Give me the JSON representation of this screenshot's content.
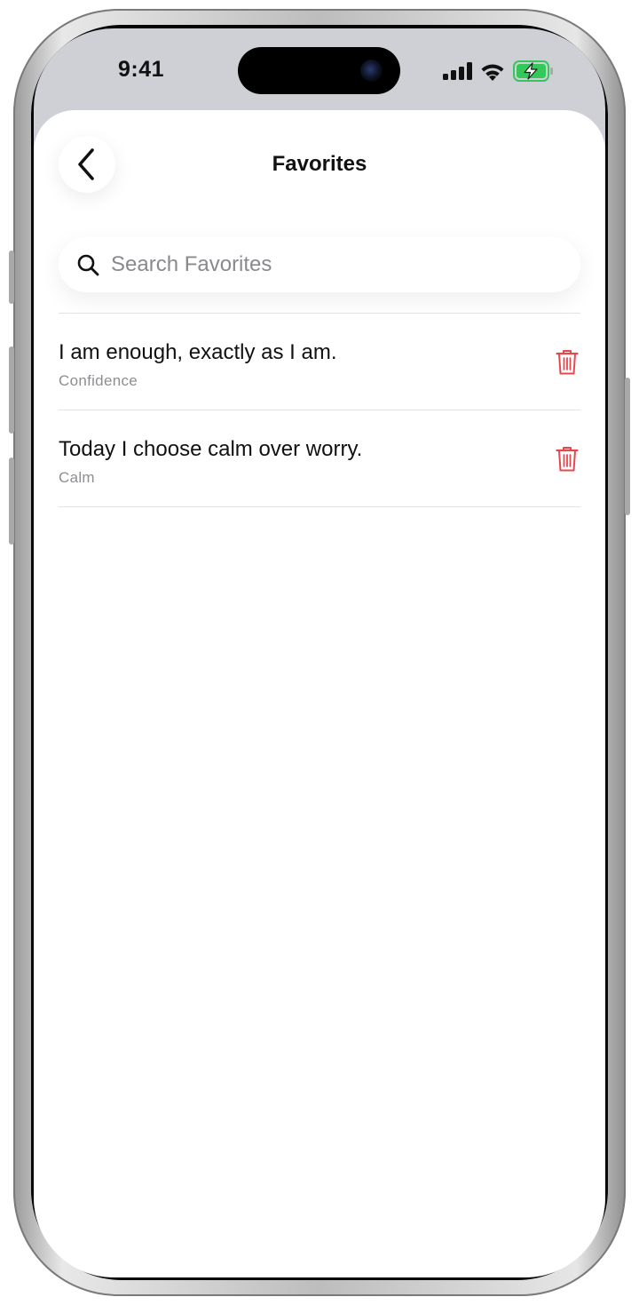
{
  "status_bar": {
    "time": "9:41",
    "icons": [
      "cellular-signal-icon",
      "wifi-icon",
      "battery-charging-icon"
    ]
  },
  "header": {
    "title": "Favorites",
    "back_icon": "chevron-left-icon"
  },
  "search": {
    "placeholder": "Search Favorites",
    "value": "",
    "icon": "magnifying-glass-icon"
  },
  "favorites": [
    {
      "text": "I am enough, exactly as I am.",
      "category": "Confidence",
      "delete_icon": "trash-icon"
    },
    {
      "text": "Today I choose calm over worry.",
      "category": "Calm",
      "delete_icon": "trash-icon"
    }
  ],
  "colors": {
    "delete": "#e5484d",
    "battery": "#34c759",
    "secondary_text": "#8e8e93"
  }
}
